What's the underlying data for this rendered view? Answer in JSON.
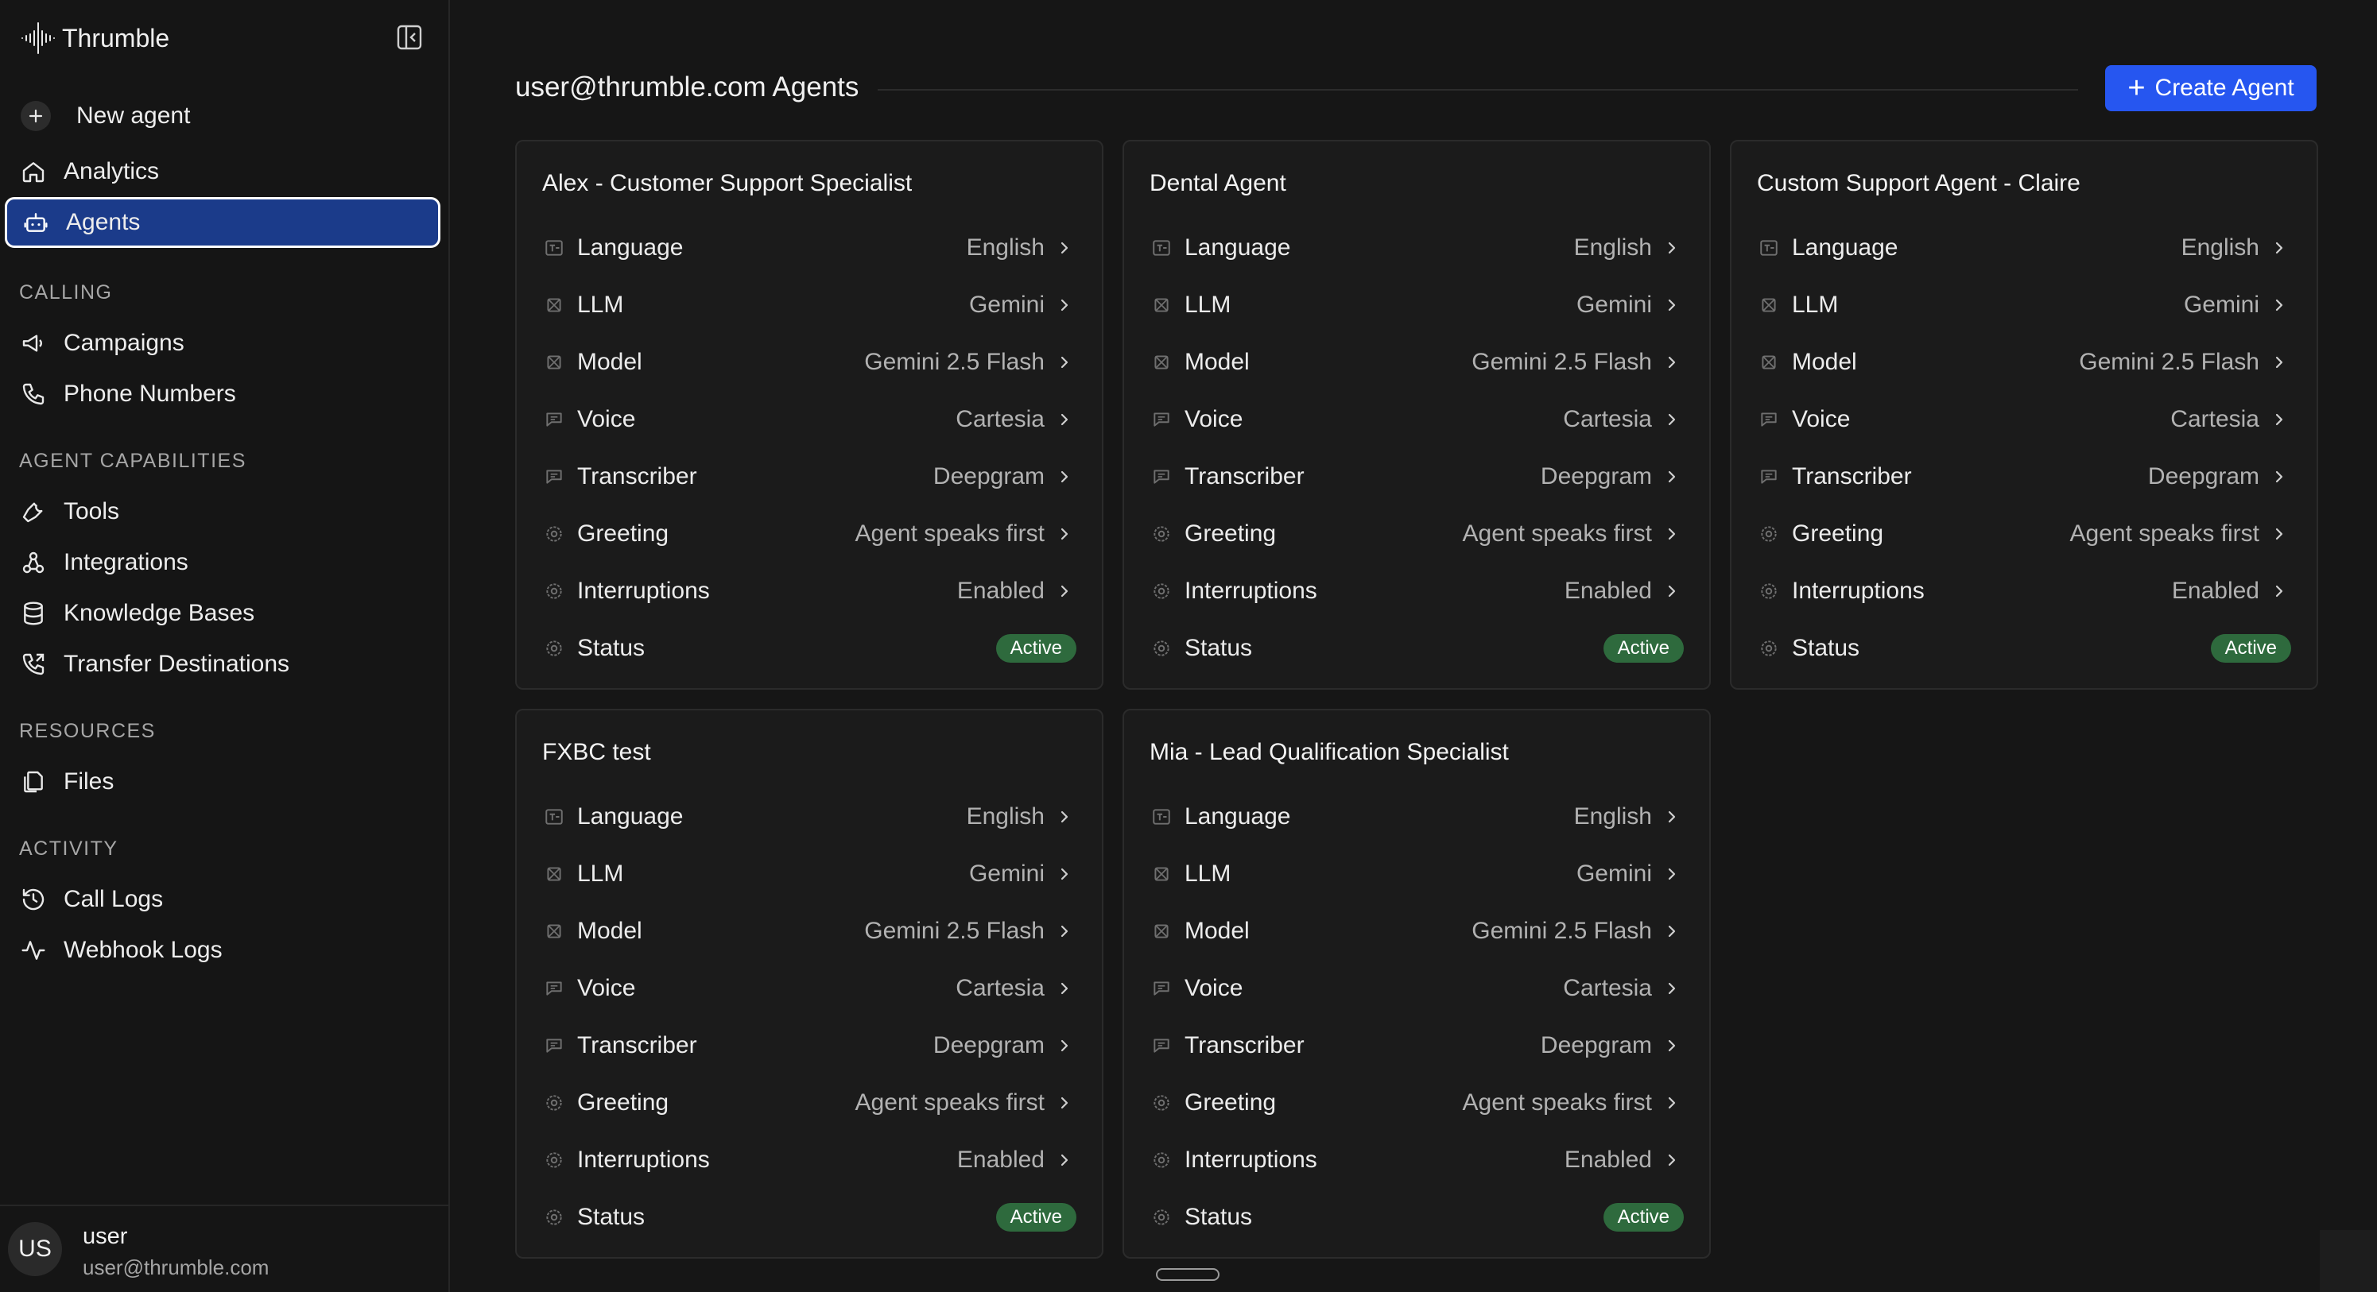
{
  "app": {
    "name": "Thrumble"
  },
  "sidebar": {
    "new_agent": "New agent",
    "analytics": "Analytics",
    "agents": "Agents",
    "sections": {
      "calling": "CALLING",
      "capabilities": "AGENT CAPABILITIES",
      "resources": "RESOURCES",
      "activity": "ACTIVITY"
    },
    "calling_items": [
      "Campaigns",
      "Phone Numbers"
    ],
    "capability_items": [
      "Tools",
      "Integrations",
      "Knowledge Bases",
      "Transfer Destinations"
    ],
    "resource_items": [
      "Files"
    ],
    "activity_items": [
      "Call Logs",
      "Webhook Logs"
    ]
  },
  "user": {
    "initials": "US",
    "name": "user",
    "email": "user@thrumble.com"
  },
  "main": {
    "title": "user@thrumble.com Agents",
    "create_button": "Create Agent"
  },
  "row_labels": {
    "language": "Language",
    "llm": "LLM",
    "model": "Model",
    "voice": "Voice",
    "transcriber": "Transcriber",
    "greeting": "Greeting",
    "interruptions": "Interruptions",
    "status": "Status"
  },
  "agents": [
    {
      "name": "Alex - Customer Support Specialist",
      "language": "English",
      "llm": "Gemini",
      "model": "Gemini 2.5 Flash",
      "voice": "Cartesia",
      "transcriber": "Deepgram",
      "greeting": "Agent speaks first",
      "interruptions": "Enabled",
      "status": "Active"
    },
    {
      "name": "Dental Agent",
      "language": "English",
      "llm": "Gemini",
      "model": "Gemini 2.5 Flash",
      "voice": "Cartesia",
      "transcriber": "Deepgram",
      "greeting": "Agent speaks first",
      "interruptions": "Enabled",
      "status": "Active"
    },
    {
      "name": "Custom Support Agent - Claire",
      "language": "English",
      "llm": "Gemini",
      "model": "Gemini 2.5 Flash",
      "voice": "Cartesia",
      "transcriber": "Deepgram",
      "greeting": "Agent speaks first",
      "interruptions": "Enabled",
      "status": "Active"
    },
    {
      "name": "FXBC test",
      "language": "English",
      "llm": "Gemini",
      "model": "Gemini 2.5 Flash",
      "voice": "Cartesia",
      "transcriber": "Deepgram",
      "greeting": "Agent speaks first",
      "interruptions": "Enabled",
      "status": "Active"
    },
    {
      "name": "Mia - Lead Qualification Specialist",
      "language": "English",
      "llm": "Gemini",
      "model": "Gemini 2.5 Flash",
      "voice": "Cartesia",
      "transcriber": "Deepgram",
      "greeting": "Agent speaks first",
      "interruptions": "Enabled",
      "status": "Active"
    }
  ],
  "colors": {
    "accent": "#2656f0",
    "active_nav": "#1b3b8a",
    "status_active": "#2e6a3d"
  }
}
